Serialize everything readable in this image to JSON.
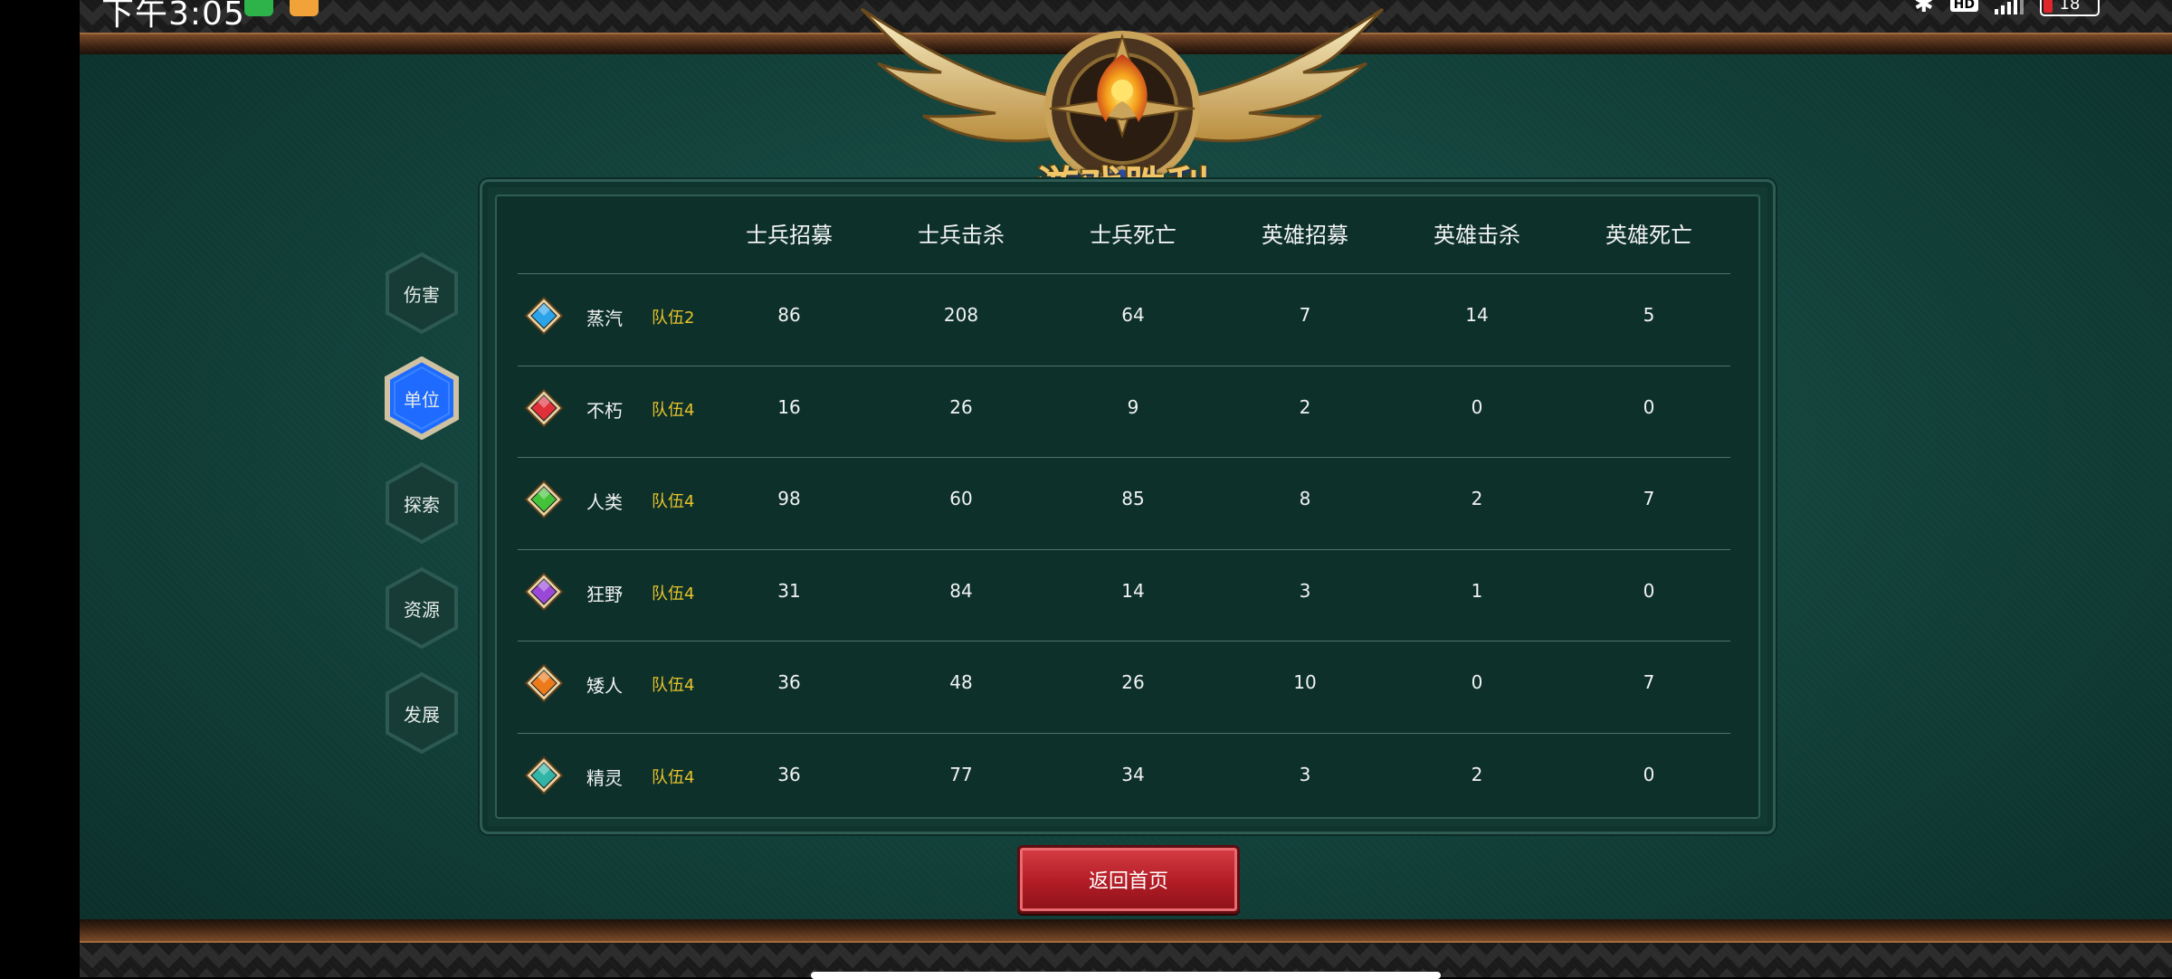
{
  "status_bar": {
    "time": "下午3:05",
    "icons": [
      "bluetooth-icon",
      "hd-icon",
      "signal-icon",
      "battery-icon"
    ],
    "hd_text": "HD",
    "battery_level": "18"
  },
  "victory_title": "游戏胜利",
  "side_tabs": [
    {
      "label": "伤害",
      "active": false
    },
    {
      "label": "单位",
      "active": true
    },
    {
      "label": "探索",
      "active": false
    },
    {
      "label": "资源",
      "active": false
    },
    {
      "label": "发展",
      "active": false
    }
  ],
  "table": {
    "columns": [
      "士兵招募",
      "士兵击杀",
      "士兵死亡",
      "英雄招募",
      "英雄击杀",
      "英雄死亡"
    ],
    "rows": [
      {
        "race": "蒸汽",
        "team": "队伍2",
        "gem_color": "#2aa3e8",
        "values": [
          "86",
          "208",
          "64",
          "7",
          "14",
          "5"
        ]
      },
      {
        "race": "不朽",
        "team": "队伍4",
        "gem_color": "#e0303a",
        "values": [
          "16",
          "26",
          "9",
          "2",
          "0",
          "0"
        ]
      },
      {
        "race": "人类",
        "team": "队伍4",
        "gem_color": "#43c23a",
        "values": [
          "98",
          "60",
          "85",
          "8",
          "2",
          "7"
        ]
      },
      {
        "race": "狂野",
        "team": "队伍4",
        "gem_color": "#9a48d8",
        "values": [
          "31",
          "84",
          "14",
          "3",
          "1",
          "0"
        ]
      },
      {
        "race": "矮人",
        "team": "队伍4",
        "gem_color": "#ec7a1a",
        "values": [
          "36",
          "48",
          "26",
          "10",
          "0",
          "7"
        ]
      },
      {
        "race": "精灵",
        "team": "队伍4",
        "gem_color": "#2fb4a6",
        "values": [
          "36",
          "77",
          "34",
          "3",
          "2",
          "0"
        ]
      }
    ]
  },
  "return_button": "返回首页",
  "colors": {
    "accent_tab": "#1f6bff",
    "team_label": "#e8c42a",
    "button_red": "#c42630",
    "background": "#14443d"
  }
}
